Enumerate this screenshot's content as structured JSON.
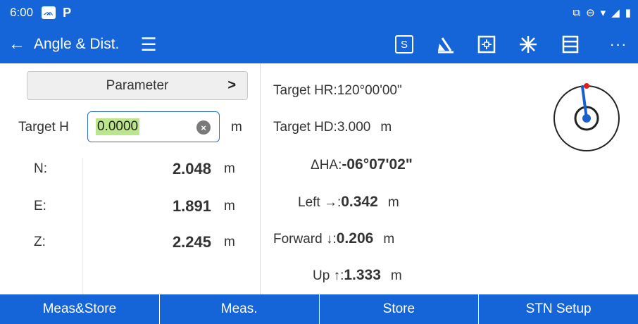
{
  "status_bar": {
    "time": "6:00",
    "badge": "ᨏ",
    "p": "P",
    "right_icons": "⊡ ⊖ ▾◢ ▮"
  },
  "app_bar": {
    "title": "Angle & Dist.",
    "s_label": "S"
  },
  "left": {
    "parameter_label": "Parameter",
    "parameter_chevron": ">",
    "target_h_label": "Target H",
    "target_h_value": "0.0000",
    "target_h_unit": "m",
    "rows": [
      {
        "label": "N:",
        "value": "2.048",
        "unit": "m"
      },
      {
        "label": "E:",
        "value": "1.891",
        "unit": "m"
      },
      {
        "label": "Z:",
        "value": "2.245",
        "unit": "m"
      }
    ]
  },
  "right": {
    "target_hr": "Target HR:120°00'00\"",
    "target_hd_label": "Target HD:",
    "target_hd_value": "3.000",
    "target_hd_unit": "m",
    "dha_label": "ΔHA:",
    "dha_value": "-06°07'02\"",
    "left_label": "Left →:",
    "left_value": "0.342",
    "left_unit": "m",
    "forward_label": "Forward ↓:",
    "forward_value": "0.206",
    "forward_unit": "m",
    "up_label": "Up ↑:",
    "up_value": "1.333",
    "up_unit": "m"
  },
  "bottom": {
    "buttons": [
      "Meas&Store",
      "Meas.",
      "Store",
      "STN Setup"
    ]
  },
  "colors": {
    "primary": "#1565d8",
    "highlight": "#bce68b",
    "needle": "#1a5fd0",
    "marker": "#e02020"
  }
}
